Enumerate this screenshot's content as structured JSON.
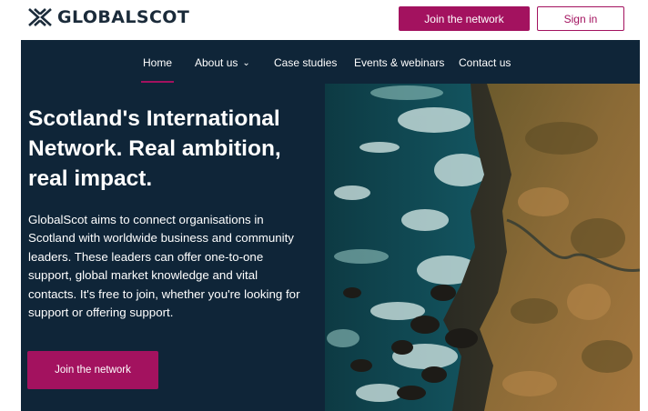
{
  "brand": {
    "name": "GLOBALSCOT"
  },
  "header": {
    "join_label": "Join the network",
    "signin_label": "Sign in"
  },
  "nav": {
    "items": [
      {
        "label": "Home",
        "active": true
      },
      {
        "label": "About us",
        "has_dropdown": true
      },
      {
        "label": "Case studies"
      },
      {
        "label": "Events & webinars"
      },
      {
        "label": "Contact us"
      }
    ]
  },
  "hero": {
    "title": "Scotland's International Network. Real ambition, real impact.",
    "body": "GlobalScot aims to connect organisations in Scotland with worldwide business and community leaders. These leaders can offer one-to-one support, global market knowledge and vital contacts. It's free to join, whether you're looking for support or offering support.",
    "cta_label": "Join the network",
    "image": "aerial-coastline-photo"
  },
  "icons": {
    "logo": "saltire-logo-icon",
    "dropdown": "chevron-down-icon"
  },
  "colors": {
    "brand": "#a3125f",
    "navy": "#0f2538",
    "logo_text": "#1b2b3a"
  }
}
